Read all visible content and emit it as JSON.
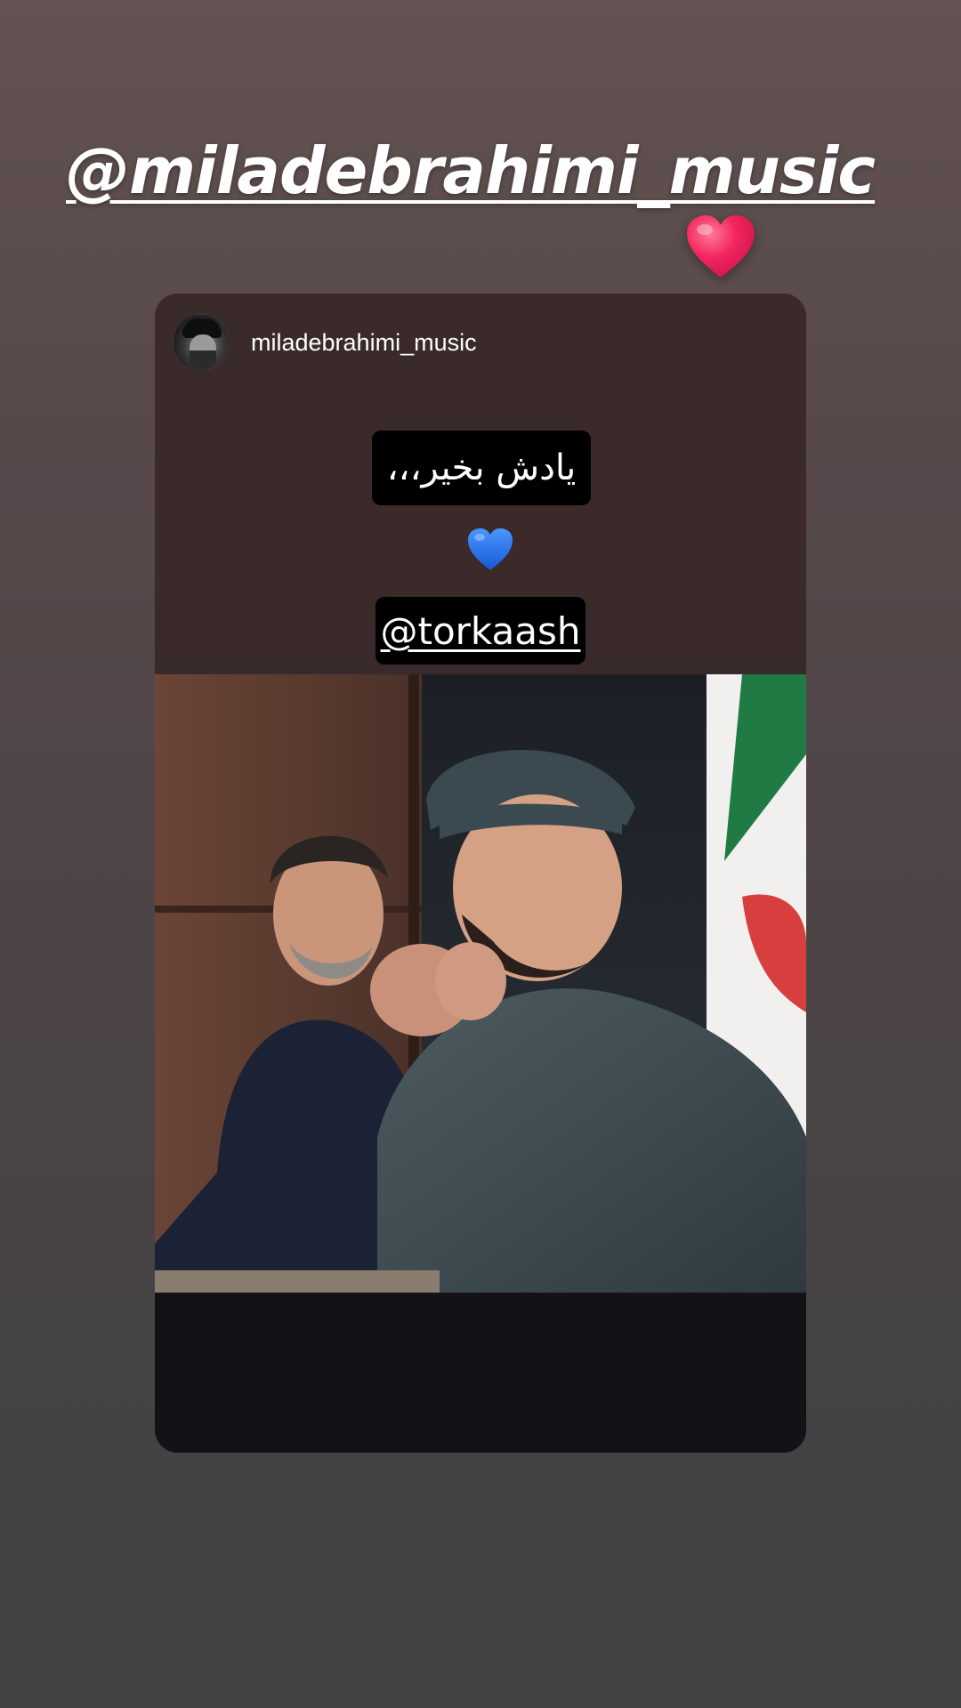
{
  "story": {
    "mention_sticker": "@miladebrahimi_music",
    "heart_sticker_icon": "red-heart-icon"
  },
  "shared_post": {
    "username": "miladebrahimi_music",
    "avatar_icon": "profile-avatar",
    "caption": "یادش بخیر،،،",
    "heart_icon": "blue-heart-icon",
    "mention": "@torkaash",
    "photo_description_icon": "post-photo"
  },
  "colors": {
    "background_top": "#635352",
    "background_bottom": "#424143",
    "card_top": "#3b2a2a",
    "card_bottom": "#141217",
    "red_heart": "#f0255e",
    "blue_heart": "#1f6fe6"
  }
}
